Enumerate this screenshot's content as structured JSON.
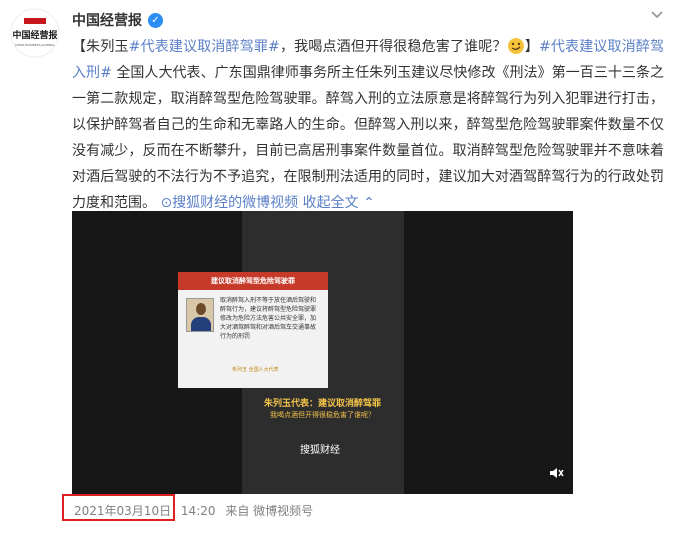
{
  "account": {
    "name": "中国经营报",
    "logo_text": "中国经营报",
    "logo_subtext": "CHINA BUSINESS JOURNAL"
  },
  "post": {
    "lead_bracket_open": "【朱列玉",
    "hashtag1": "#代表建议取消醉驾罪#",
    "lead_text": "，我喝点酒但开得很稳危害了谁呢？",
    "lead_bracket_close": "】",
    "hashtag2": "#代表建议取消醉驾入刑#",
    "body": " 全国人大代表、广东国鼎律师事务所主任朱列玉建议尽快修改《刑法》第一百三十三条之一第二款规定，取消醉驾型危险驾驶罪。醉驾入刑的立法原意是将醉驾行为列入犯罪进行打击，以保护醉驾者自己的生命和无辜路人的生命。但醉驾入刑以来，醉驾型危险驾驶罪案件数量不仅没有减少，反而在不断攀升，目前已高居刑事案件数量首位。取消醉驾型危险驾驶罪并不意味着对酒后驾驶的不法行为不予追究，在限制刑法适用的同时，建议加大对酒驾醉驾行为的行政处罚力度和范围。",
    "video_link": "搜狐财经的微博视频",
    "collapse": "收起全文"
  },
  "video": {
    "card_title": "建议取消醉驾型危险驾驶罪",
    "card_text": "取消醉驾入刑不等于放任酒后驾驶和醉驾行为，建议将醉驾型危险驾驶罪修改为危险方法危害公共安全罪，加大对酒驾醉驾和对酒后驾车交通事故行为的刑罚",
    "person_name": "朱列玉",
    "person_title": "全国人大代表",
    "caption1": "朱列玉代表：建议取消醉驾罪",
    "caption2": "我喝点酒但开得很稳危害了谁呢？",
    "watermark": "搜狐财经"
  },
  "meta": {
    "date": "2021年03月10日",
    "time": "14:20",
    "source": "来自 微博视频号"
  },
  "colors": {
    "link": "#5a7fc7",
    "highlight_box": "#e02020",
    "verified": "#2a8ef3",
    "caption": "#f2c34a"
  }
}
